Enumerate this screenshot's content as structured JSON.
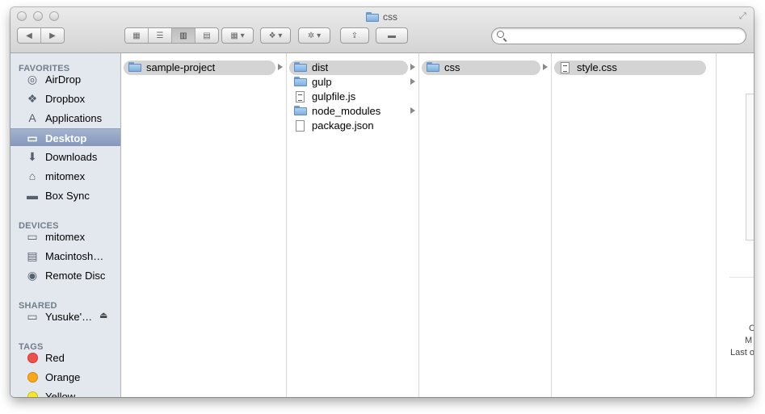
{
  "window": {
    "title": "css"
  },
  "toolbar": {
    "back_icon": "back-arrow-icon",
    "forward_icon": "forward-arrow-icon",
    "views": [
      {
        "name": "icon-view",
        "glyph": "▦"
      },
      {
        "name": "list-view",
        "glyph": "☰"
      },
      {
        "name": "column-view",
        "glyph": "▥"
      },
      {
        "name": "coverflow-view",
        "glyph": "▤"
      }
    ],
    "search": {
      "placeholder": "",
      "value": ""
    }
  },
  "sidebar": {
    "favorites_label": "FAVORITES",
    "favorites": [
      {
        "label": "AirDrop",
        "icon": "airdrop-icon"
      },
      {
        "label": "Dropbox",
        "icon": "dropbox-icon"
      },
      {
        "label": "Applications",
        "icon": "applications-icon"
      },
      {
        "label": "Desktop",
        "icon": "desktop-icon",
        "selected": true
      },
      {
        "label": "Downloads",
        "icon": "downloads-icon"
      },
      {
        "label": "mitomex",
        "icon": "home-icon"
      },
      {
        "label": "Box Sync",
        "icon": "folder-icon"
      }
    ],
    "devices_label": "DEVICES",
    "devices": [
      {
        "label": "mitomex",
        "icon": "laptop-icon"
      },
      {
        "label": "Macintosh…",
        "icon": "hard-drive-icon"
      },
      {
        "label": "Remote Disc",
        "icon": "disc-icon"
      }
    ],
    "shared_label": "SHARED",
    "shared": [
      {
        "label": "Yusuke'…",
        "icon": "monitor-icon"
      }
    ],
    "tags_label": "TAGS",
    "tags": [
      {
        "label": "Red",
        "color": "#f0504a"
      },
      {
        "label": "Orange",
        "color": "#f9a81a"
      },
      {
        "label": "Yellow",
        "color": "#f5e62a"
      }
    ]
  },
  "columns": [
    [
      {
        "label": "sample-project",
        "type": "folder",
        "selected": true,
        "has_children": true
      }
    ],
    [
      {
        "label": "dist",
        "type": "folder",
        "selected": true,
        "has_children": true
      },
      {
        "label": "gulp",
        "type": "folder",
        "has_children": true
      },
      {
        "label": "gulpfile.js",
        "type": "file-code"
      },
      {
        "label": "node_modules",
        "type": "folder",
        "has_children": true
      },
      {
        "label": "package.json",
        "type": "file"
      }
    ],
    [
      {
        "label": "css",
        "type": "folder",
        "selected": true,
        "has_children": true
      }
    ],
    [
      {
        "label": "style.css",
        "type": "file-code",
        "selected": true
      }
    ]
  ],
  "preview": {
    "line1": "C",
    "line2": "M",
    "line3": "Last o"
  }
}
